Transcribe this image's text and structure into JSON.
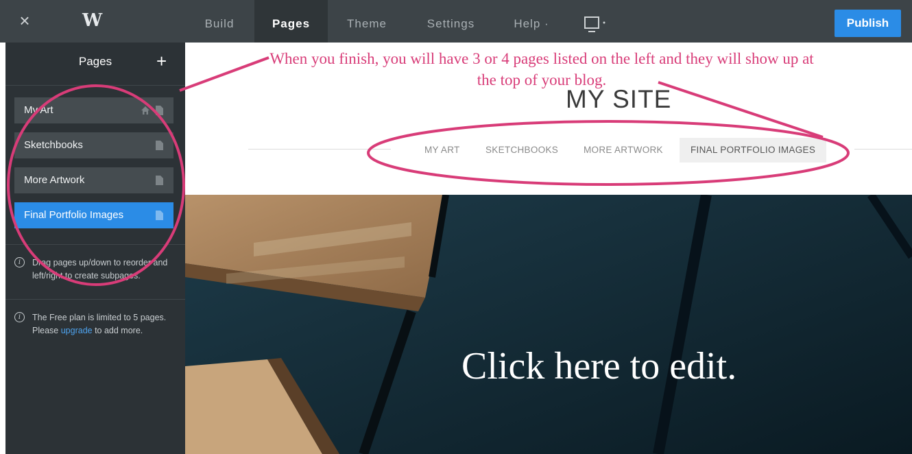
{
  "topbar": {
    "close_icon": "close-icon",
    "logo_icon": "weebly-logo-icon",
    "logo_glyph": "W",
    "tabs": [
      {
        "label": "Build"
      },
      {
        "label": "Pages"
      },
      {
        "label": "Theme"
      },
      {
        "label": "Settings"
      },
      {
        "label": "Help ·"
      }
    ],
    "active_tab": "Pages",
    "device_icon": "monitor-icon",
    "publish_label": "Publish",
    "accent": "#2b8ce6"
  },
  "sidebar": {
    "title": "Pages",
    "add_icon": "plus-icon",
    "pages": [
      {
        "label": "My Art",
        "home": true
      },
      {
        "label": "Sketchbooks"
      },
      {
        "label": "More Artwork"
      },
      {
        "label": "Final Portfolio Images",
        "selected": true
      }
    ],
    "note_drag": "Drag pages up/down to reorder and left/right to create subpages.",
    "note_plan_before": "The Free plan is limited to 5 pages. Please",
    "note_plan_link": "upgrade",
    "note_plan_after": "to add more."
  },
  "annotation": {
    "text": "When you finish, you will have 3 or 4 pages listed on the left and they will show up at the top of your blog.",
    "color": "#d83c78"
  },
  "site": {
    "title": "MY SITE",
    "nav": [
      "MY ART",
      "SKETCHBOOKS",
      "MORE ARTWORK",
      "FINAL PORTFOLIO IMAGES"
    ],
    "hero_text": "Click here to edit."
  }
}
